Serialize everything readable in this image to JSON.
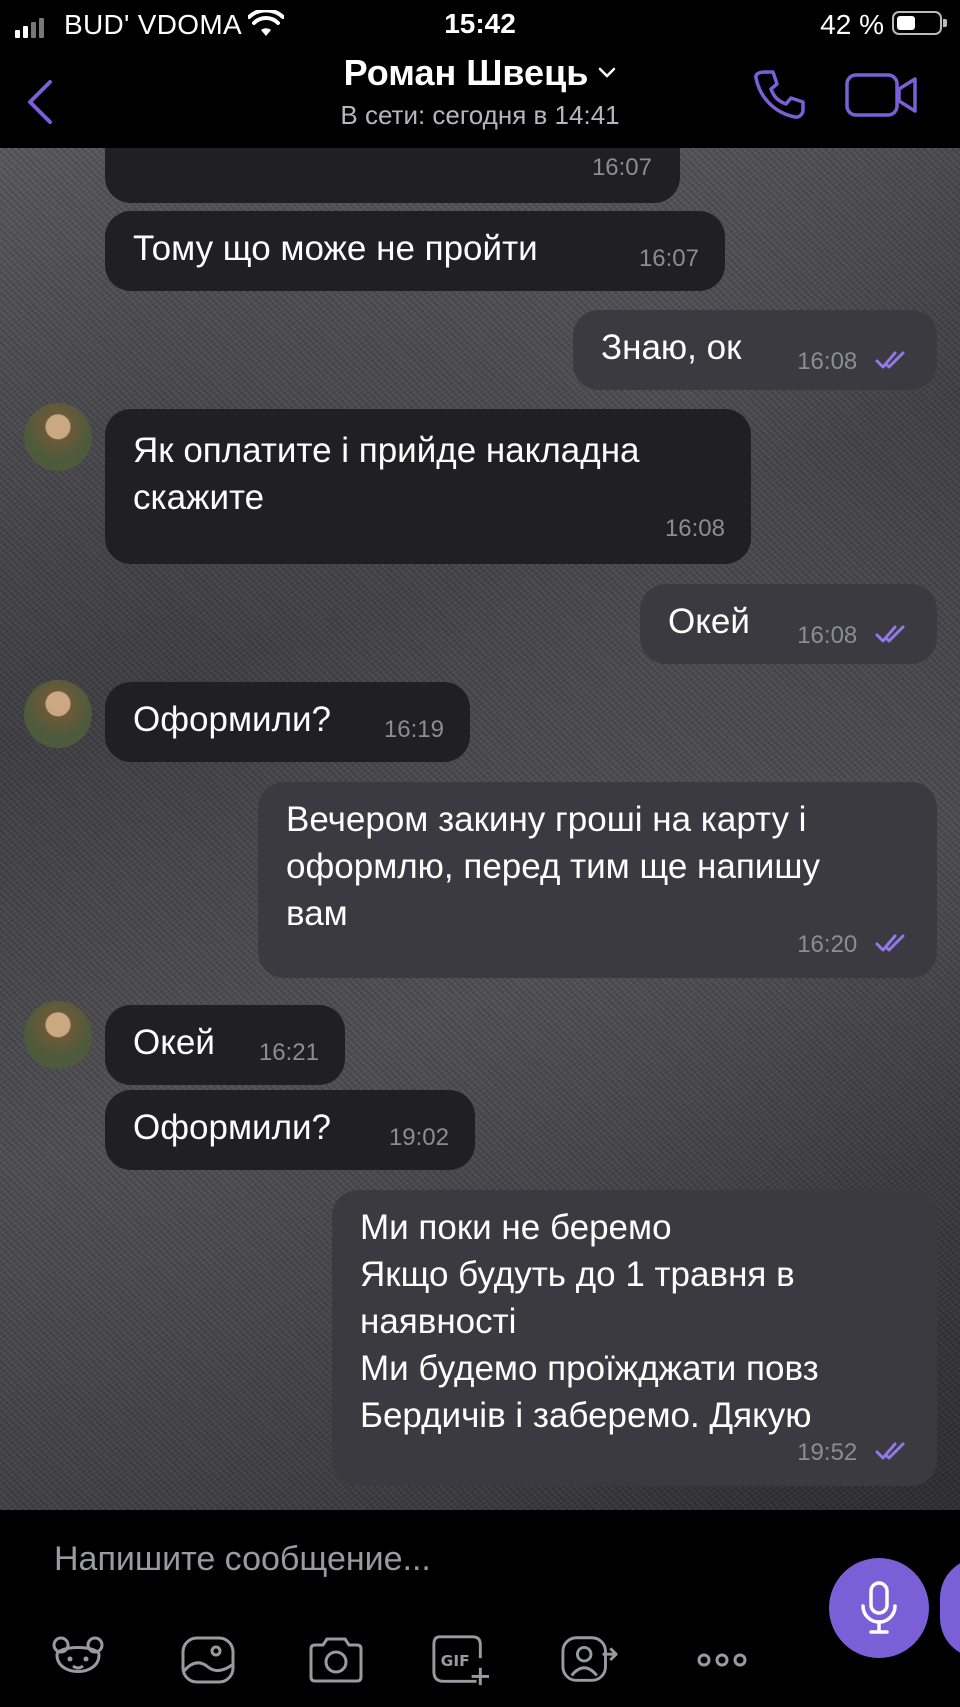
{
  "status_bar": {
    "carrier": "BUD' VDOMA",
    "time": "15:42",
    "battery": "42 %"
  },
  "header": {
    "contact_name": "Роман Швець",
    "last_seen": "В сети: сегодня в 14:41"
  },
  "messages": [
    {
      "direction": "in",
      "text": "",
      "time": "16:07"
    },
    {
      "direction": "in",
      "text": "Тому що може не пройти",
      "time": "16:07"
    },
    {
      "direction": "out",
      "text": "Знаю, ок",
      "time": "16:08",
      "read": true
    },
    {
      "direction": "in",
      "text": "Як оплатите і прийде накладна\nскажите",
      "time": "16:08",
      "avatar": true
    },
    {
      "direction": "out",
      "text": "Окей",
      "time": "16:08",
      "read": true
    },
    {
      "direction": "in",
      "text": "Оформили?",
      "time": "16:19",
      "avatar": true
    },
    {
      "direction": "out",
      "text": "Вечером закину гроші на карту і\nоформлю, перед тим ще напишу\nвам",
      "time": "16:20",
      "read": true
    },
    {
      "direction": "in",
      "text": "Окей",
      "time": "16:21",
      "avatar": true
    },
    {
      "direction": "in",
      "text": "Оформили?",
      "time": "19:02"
    },
    {
      "direction": "out",
      "text": "Ми поки не беремо\nЯкщо будуть до 1 травня в\nнаявності\nМи будемо проїжджати повз\nБердичів і заберемо. Дякую",
      "time": "19:52",
      "read": true
    }
  ],
  "composer": {
    "placeholder": "Напишите сообщение...",
    "toolbar_icons": [
      "sticker-icon",
      "gallery-icon",
      "camera-icon",
      "gif-icon",
      "share-contact-icon",
      "more-icon"
    ]
  },
  "colors": {
    "accent": "#7b5fd6",
    "bubble_in": "#1f1f24",
    "bubble_out": "#3a3a40"
  }
}
